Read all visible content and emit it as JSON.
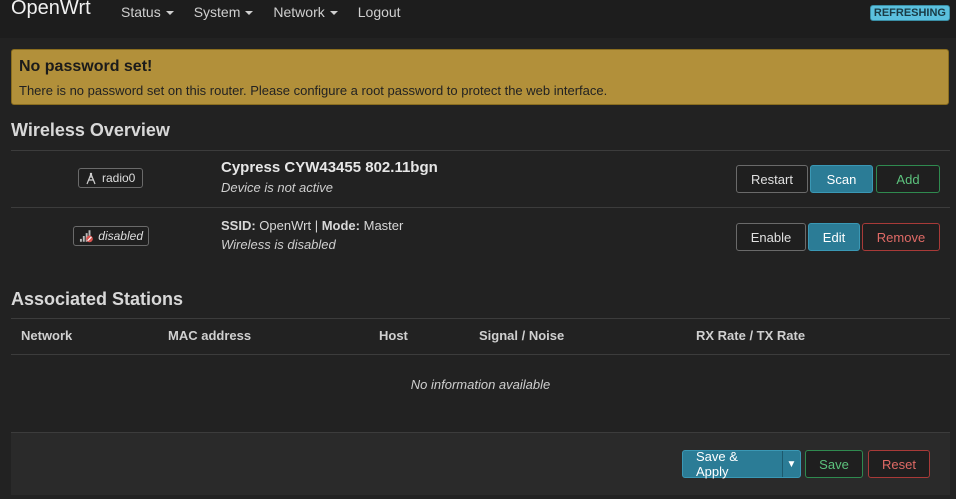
{
  "header": {
    "brand": "OpenWrt",
    "nav": [
      {
        "label": "Status",
        "dropdown": true
      },
      {
        "label": "System",
        "dropdown": true
      },
      {
        "label": "Network",
        "dropdown": true
      },
      {
        "label": "Logout",
        "dropdown": false
      }
    ],
    "badge": "REFRESHING"
  },
  "alert": {
    "title": "No password set!",
    "text": "There is no password set on this router. Please configure a root password to protect the web interface."
  },
  "wireless": {
    "heading": "Wireless Overview",
    "device": {
      "badge": "radio0",
      "title": "Cypress CYW43455 802.11bgn",
      "status": "Device is not active",
      "buttons": {
        "restart": "Restart",
        "scan": "Scan",
        "add": "Add"
      }
    },
    "network": {
      "badge": "disabled",
      "ssid_label": "SSID:",
      "ssid": "OpenWrt",
      "sep": "|",
      "mode_label": "Mode:",
      "mode": "Master",
      "status": "Wireless is disabled",
      "buttons": {
        "enable": "Enable",
        "edit": "Edit",
        "remove": "Remove"
      }
    }
  },
  "stations": {
    "heading": "Associated Stations",
    "columns": [
      "Network",
      "MAC address",
      "Host",
      "Signal / Noise",
      "RX Rate / TX Rate"
    ],
    "empty": "No information available"
  },
  "footer": {
    "save_apply": "Save & Apply",
    "save": "Save",
    "reset": "Reset"
  },
  "colors": {
    "accent": "#2b7c96",
    "warning": "#b2903a",
    "success": "#2f8a4f",
    "danger": "#a83a38"
  }
}
